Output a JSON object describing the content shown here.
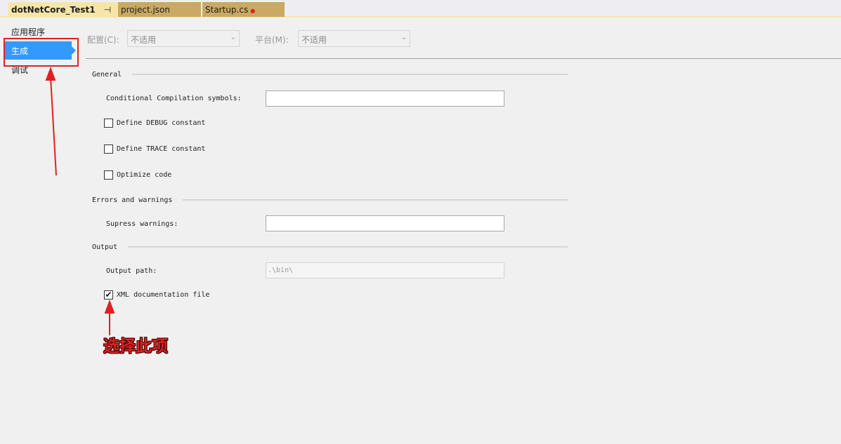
{
  "tabs": [
    {
      "label": "dotNetCore_Test1",
      "pin": "⊣",
      "close": "✕"
    },
    {
      "label": "project.json"
    },
    {
      "label": "Startup.cs",
      "dot": "●"
    }
  ],
  "nav": {
    "items": [
      {
        "label": "应用程序"
      },
      {
        "label": "生成"
      },
      {
        "label": "调试"
      }
    ]
  },
  "toolbar": {
    "config_label": "配置(C):",
    "config_value": "不适用",
    "platform_label": "平台(M):",
    "platform_value": "不适用"
  },
  "general": {
    "title": "General",
    "symbols_label": "Conditional Compilation symbols:",
    "symbols_value": "",
    "debug_label": "Define DEBUG constant",
    "trace_label": "Define TRACE constant",
    "optimize_label": "Optimize code"
  },
  "errors": {
    "title": "Errors and warnings",
    "suppress_label": "Supress warnings:",
    "suppress_value": ""
  },
  "output": {
    "title": "Output",
    "path_label": "Output path:",
    "path_value": ".\\bin\\",
    "xml_label": "XML documentation file",
    "xml_checked": true
  },
  "annotation": {
    "text": "选择此项"
  }
}
